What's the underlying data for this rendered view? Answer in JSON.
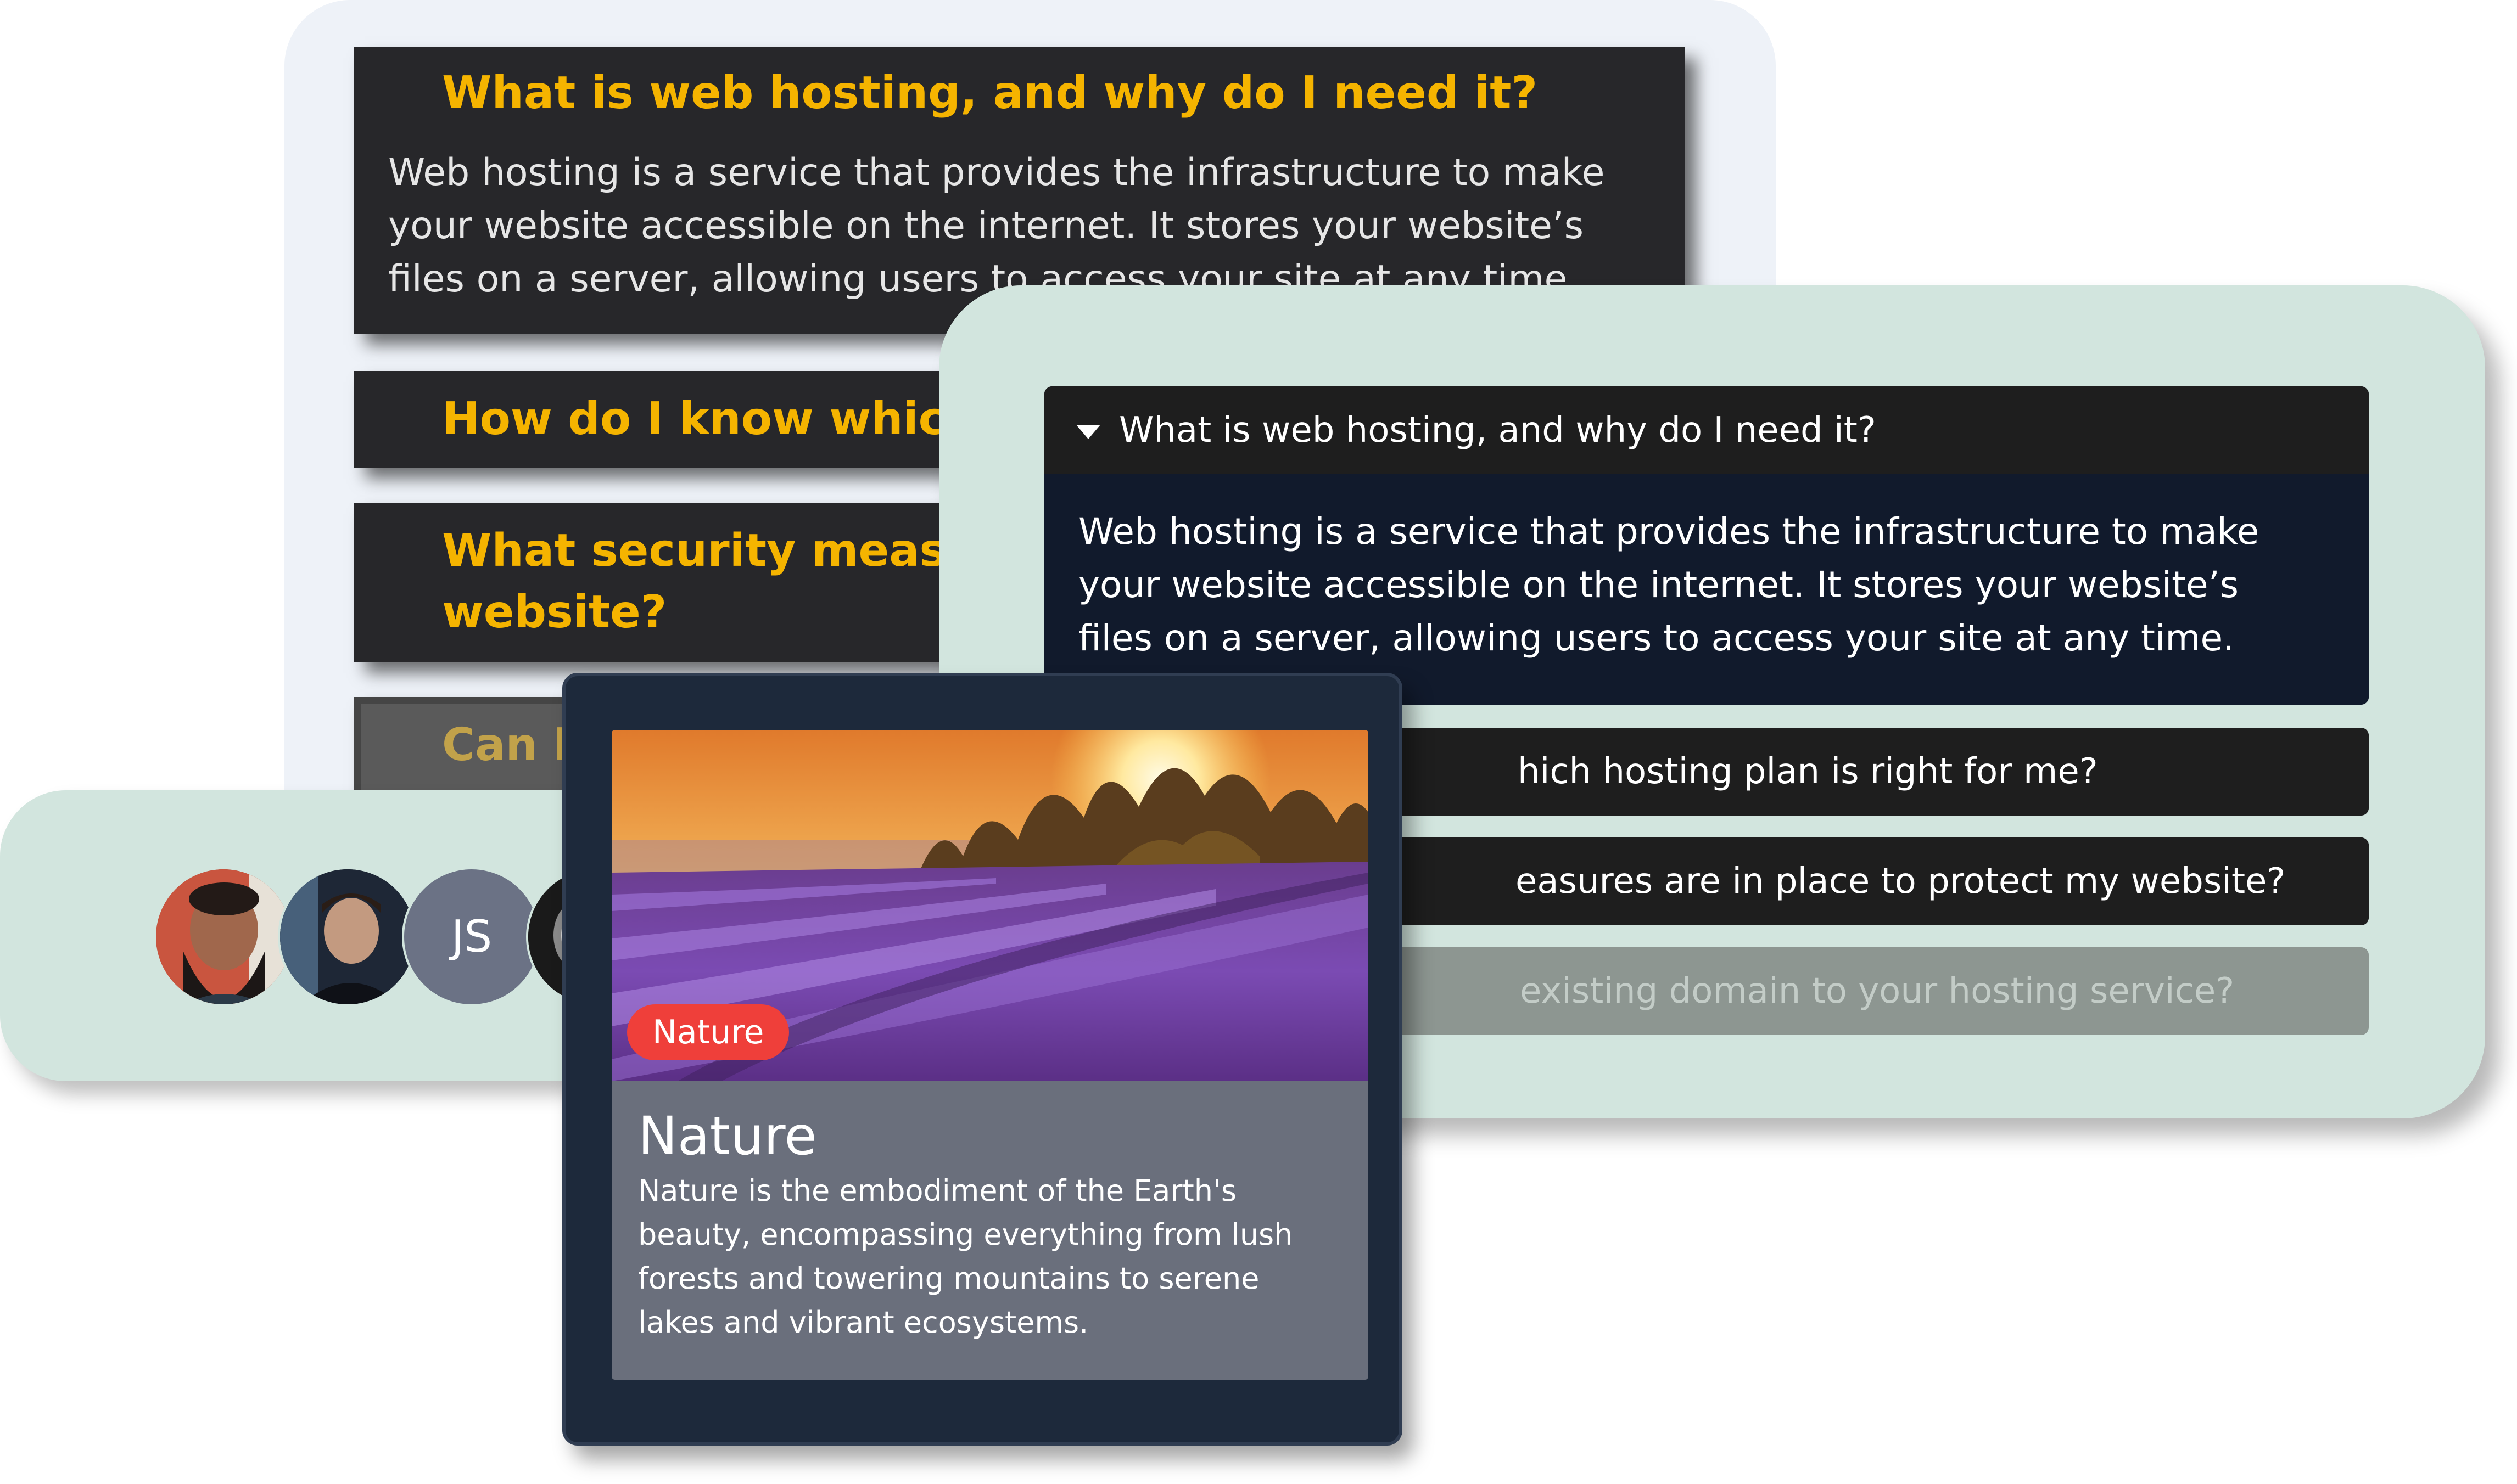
{
  "faq_yellow": {
    "items": [
      {
        "question": "What is web hosting, and why do I need it?",
        "answer": "Web hosting is a service that provides the infrastructure to make your website accessible on the internet. It stores your website’s files on a server, allowing users to access your site at any time."
      },
      {
        "question": "How do I know which h"
      },
      {
        "question": "What security measure"
      },
      {
        "question_line2": "website?"
      },
      {
        "question": "Can I"
      }
    ]
  },
  "accordion": {
    "items": [
      {
        "question": "What is web hosting, and why do I need it?",
        "answer": "Web hosting is a service that provides the infrastructure to make your website accessible on the internet. It stores your website’s files on a server, allowing users to access your site at any time.",
        "expanded": true
      },
      {
        "question": "hich hosting plan is right for me?",
        "expanded": false
      },
      {
        "question": "easures are in place to protect my website?",
        "expanded": false
      },
      {
        "question": "existing domain to your hosting service?",
        "expanded": false
      }
    ]
  },
  "avatars": {
    "initials": "JS"
  },
  "card": {
    "badge": "Nature",
    "title": "Nature",
    "description": "Nature is the embodiment of the Earth's beauty, encompassing everything from lush forests and towering mountains to serene lakes and vibrant ecosystems."
  }
}
